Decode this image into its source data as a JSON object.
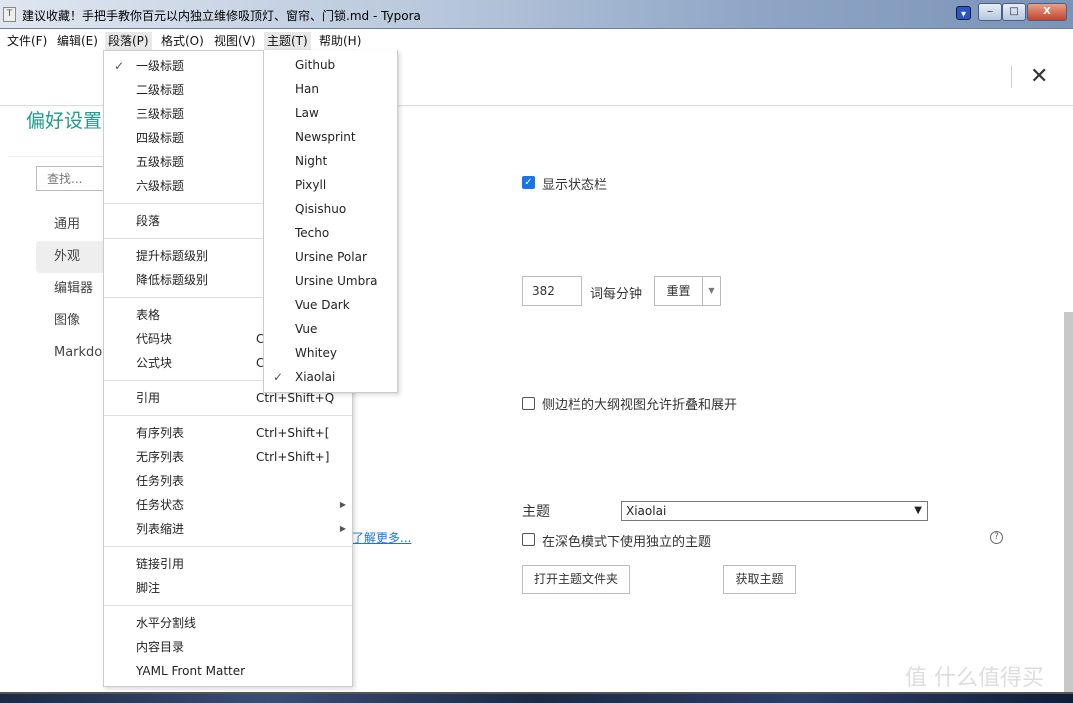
{
  "window": {
    "title": "建议收藏！手把手教你百元以内独立维修吸顶灯、窗帘、门锁.md - Typora",
    "app_icon": "T",
    "minimize": "‒",
    "maximize": "□",
    "close": "X"
  },
  "menubar": [
    "文件(F)",
    "编辑(E)",
    "段落(P)",
    "格式(O)",
    "视图(V)",
    "主题(T)",
    "帮助(H)"
  ],
  "preferences": {
    "title": "偏好设置",
    "close": "✕",
    "search_placeholder": "查找...",
    "sidebar": [
      "通用",
      "外观",
      "编辑器",
      "图像",
      "Markdown"
    ],
    "selected": "外观",
    "show_status_bar": {
      "label": "显示状态栏",
      "checked": true
    },
    "words_per_minute": {
      "value": "382",
      "label": "词每分钟",
      "reset": "重置"
    },
    "outline_collapse": {
      "label": "侧边栏的大纲视图允许折叠和展开",
      "checked": false
    },
    "theme": {
      "label": "主题",
      "value": "Xiaolai"
    },
    "dark_theme": {
      "label": "在深色模式下使用独立的主题",
      "checked": false
    },
    "learn_more": "了解更多...",
    "open_theme_folder": "打开主题文件夹",
    "get_themes": "获取主题"
  },
  "paragraph_menu": [
    {
      "label": "一级标题",
      "checked": true
    },
    {
      "label": "二级标题"
    },
    {
      "label": "三级标题"
    },
    {
      "label": "四级标题"
    },
    {
      "label": "五级标题"
    },
    {
      "label": "六级标题"
    },
    {
      "sep": true
    },
    {
      "label": "段落"
    },
    {
      "sep": true
    },
    {
      "label": "提升标题级别"
    },
    {
      "label": "降低标题级别"
    },
    {
      "sep": true
    },
    {
      "label": "表格"
    },
    {
      "label": "代码块",
      "shortcut": "C"
    },
    {
      "label": "公式块",
      "shortcut": "Ct"
    },
    {
      "sep": true
    },
    {
      "label": "引用",
      "shortcut": "Ctrl+Shift+Q"
    },
    {
      "sep": true
    },
    {
      "label": "有序列表",
      "shortcut": "Ctrl+Shift+["
    },
    {
      "label": "无序列表",
      "shortcut": "Ctrl+Shift+]"
    },
    {
      "label": "任务列表"
    },
    {
      "label": "任务状态",
      "submenu": true
    },
    {
      "label": "列表缩进",
      "submenu": true
    },
    {
      "sep": true
    },
    {
      "label": "链接引用"
    },
    {
      "label": "脚注"
    },
    {
      "sep": true
    },
    {
      "label": "水平分割线"
    },
    {
      "label": "内容目录"
    },
    {
      "label": "YAML Front Matter"
    }
  ],
  "theme_menu": [
    {
      "label": "Github"
    },
    {
      "label": "Han"
    },
    {
      "label": "Law"
    },
    {
      "label": "Newsprint"
    },
    {
      "label": "Night"
    },
    {
      "label": "Pixyll"
    },
    {
      "label": "Qisishuo"
    },
    {
      "label": "Techo"
    },
    {
      "label": "Ursine Polar"
    },
    {
      "label": "Ursine Umbra"
    },
    {
      "label": "Vue Dark"
    },
    {
      "label": "Vue"
    },
    {
      "label": "Whitey"
    },
    {
      "label": "Xiaolai",
      "checked": true
    }
  ],
  "watermark": "值 什么值得买",
  "colors": {
    "accent": "#1f9c8c",
    "link": "#1a73e8"
  }
}
